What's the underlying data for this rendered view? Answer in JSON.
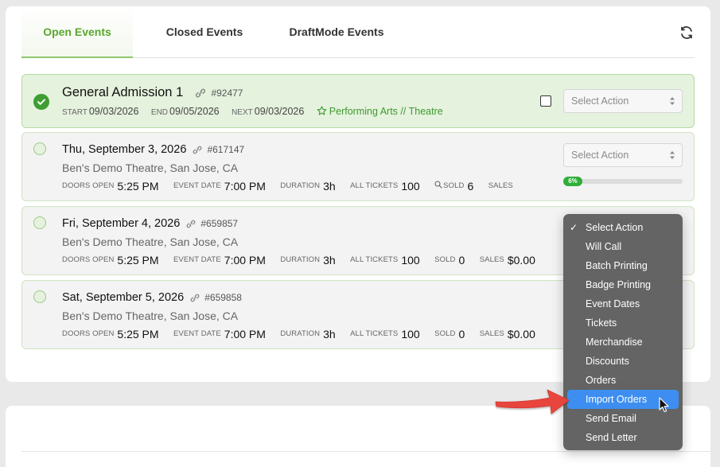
{
  "tabs": [
    {
      "label": "Open Events",
      "active": true
    },
    {
      "label": "Closed Events",
      "active": false
    },
    {
      "label": "DraftMode Events",
      "active": false
    }
  ],
  "toolbar": {
    "refresh_icon": "refresh-icon"
  },
  "event_group": {
    "title": "General Admission 1",
    "id": "#92477",
    "start_label": "START",
    "start": "09/03/2026",
    "end_label": "END",
    "end": "09/05/2026",
    "next_label": "NEXT",
    "next": "09/03/2026",
    "category": "Performing Arts // Theatre",
    "select_placeholder": "Select Action"
  },
  "labels": {
    "doors_open": "DOORS OPEN",
    "event_date": "EVENT DATE",
    "duration": "DURATION",
    "all_tickets": "ALL TICKETS",
    "sold": "SOLD",
    "sales": "SALES"
  },
  "events": [
    {
      "date": "Thu, September 3, 2026",
      "id": "#617147",
      "venue": "Ben's Demo Theatre, San Jose, CA",
      "doors_open": "5:25 PM",
      "event_date": "7:00 PM",
      "duration": "3h",
      "all_tickets": "100",
      "sold": "6",
      "sales": "",
      "select_placeholder": "Select Action",
      "progress_label": "6%",
      "progress": 0.06
    },
    {
      "date": "Fri, September 4, 2026",
      "id": "#659857",
      "venue": "Ben's Demo Theatre, San Jose, CA",
      "doors_open": "5:25 PM",
      "event_date": "7:00 PM",
      "duration": "3h",
      "all_tickets": "100",
      "sold": "0",
      "sales": "$0.00"
    },
    {
      "date": "Sat, September 5, 2026",
      "id": "#659858",
      "venue": "Ben's Demo Theatre, San Jose, CA",
      "doors_open": "5:25 PM",
      "event_date": "7:00 PM",
      "duration": "3h",
      "all_tickets": "100",
      "sold": "0",
      "sales": "$0.00"
    }
  ],
  "action_menu": {
    "items": [
      "Select Action",
      "Will Call",
      "Batch Printing",
      "Badge Printing",
      "Event Dates",
      "Tickets",
      "Merchandise",
      "Discounts",
      "Orders",
      "Import Orders",
      "Send Email",
      "Send Letter"
    ],
    "selected": "Select Action",
    "highlighted": "Import Orders"
  },
  "colors": {
    "accent_green": "#5aa72d",
    "menu_highlight": "#3d8ef0",
    "annotation_arrow": "#e8453c"
  }
}
